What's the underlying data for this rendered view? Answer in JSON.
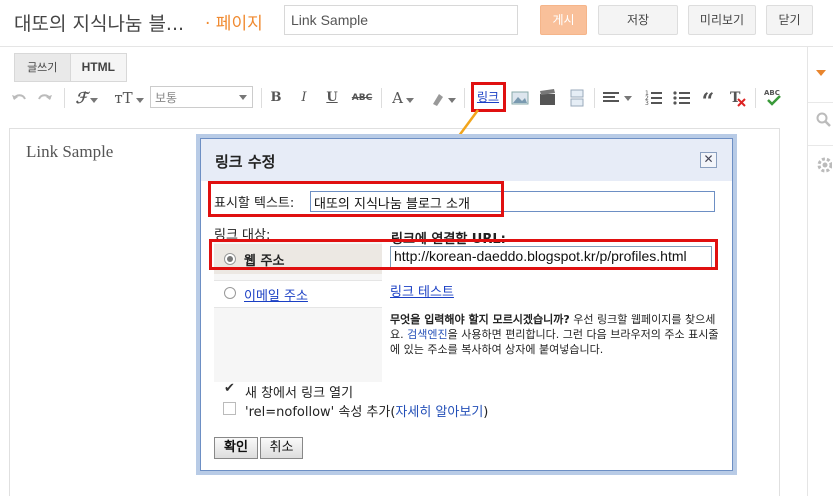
{
  "header": {
    "blog_title": "대또의 지식나눔 블...",
    "page_label": "· 페이지",
    "post_title_value": "Link Sample",
    "publish": "게시",
    "save": "저장",
    "preview": "미리보기",
    "close": "닫기"
  },
  "modes": {
    "compose": "글쓰기",
    "html": "HTML"
  },
  "toolbar": {
    "font_size": "보통",
    "bold": "B",
    "italic": "I",
    "underline": "U",
    "strike": "ABC",
    "text_color": "A",
    "link": "링크",
    "spellcheck": "ABC"
  },
  "editor": {
    "content": "Link Sample"
  },
  "dialog": {
    "title": "링크 수정",
    "display_text_label": "표시할 텍스트:",
    "display_text_value": "대또의 지식나눔 블로그 소개",
    "target_label": "링크 대상:",
    "option_web": "웹 주소",
    "option_email": "이메일 주소",
    "url_label": "링크에 연결할 URL:",
    "url_value": "http://korean-daeddo.blogspot.kr/p/profiles.html",
    "test_link": "링크 테스트",
    "help_bold": "무엇을 입력해야 할지 모르시겠습니까?",
    "help_text_1": " 우선 링크할 웹페이지를 찾으세요. ",
    "help_link": "검색엔진",
    "help_text_2": "을 사용하면 편리합니다. 그런 다음 브라우저의 주소 표시줄에 있는 주소를 복사하여 상자에 붙여넣습니다.",
    "new_window_label": "새 창에서 링크 열기",
    "new_window_checked": true,
    "nofollow_label_prefix": "'rel=nofollow' 속성 추가(",
    "nofollow_link": "자세히 알아보기",
    "nofollow_label_suffix": ")",
    "nofollow_checked": false,
    "ok": "확인",
    "cancel": "취소"
  },
  "colors": {
    "accent": "#f08a30",
    "annotation_red": "#e01010",
    "arrow_orange": "#f2a51c",
    "dialog_border": "#6d8fc4"
  }
}
